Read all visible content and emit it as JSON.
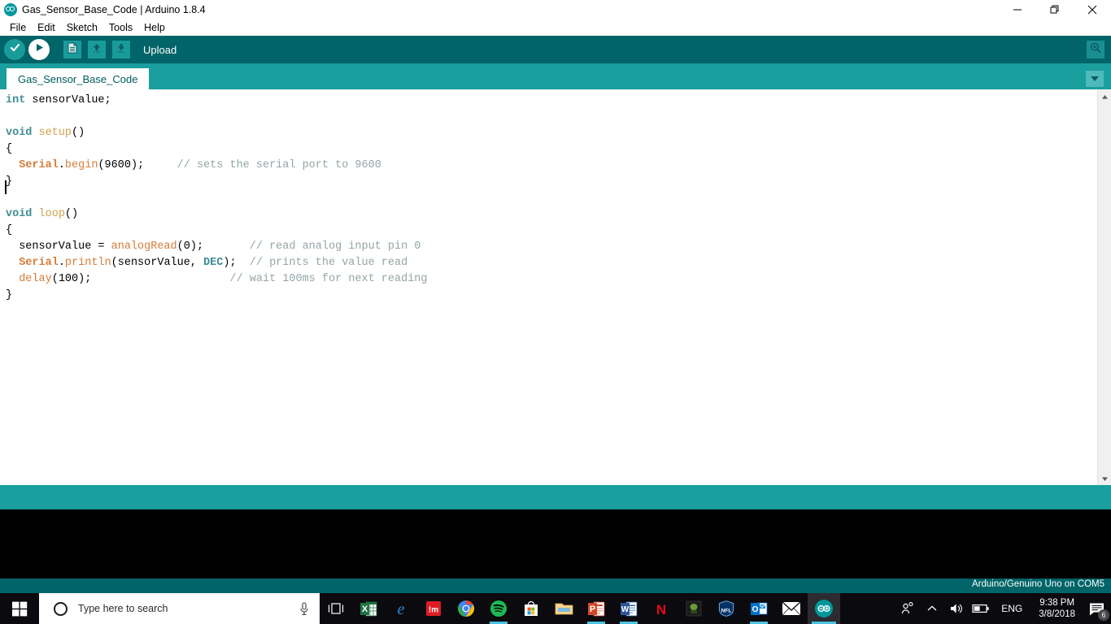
{
  "window": {
    "title": "Gas_Sensor_Base_Code | Arduino 1.8.4",
    "logo_icon": "arduino-infinity-icon",
    "controls": {
      "minimize": "minimize-icon",
      "restore": "restore-icon",
      "close": "close-icon"
    }
  },
  "menubar": {
    "items": [
      {
        "label": "File"
      },
      {
        "label": "Edit"
      },
      {
        "label": "Sketch"
      },
      {
        "label": "Tools"
      },
      {
        "label": "Help"
      }
    ]
  },
  "toolbar": {
    "verify_icon": "check-icon",
    "upload_icon": "arrow-right-icon",
    "new_icon": "new-file-icon",
    "open_icon": "open-arrow-up-icon",
    "save_icon": "save-arrow-down-icon",
    "tooltip": "Upload",
    "serial_monitor_icon": "magnifier-serial-monitor-icon"
  },
  "tabs": {
    "items": [
      {
        "label": "Gas_Sensor_Base_Code",
        "active": true
      }
    ],
    "menu_icon": "chevron-down-icon"
  },
  "editor": {
    "lines": [
      [
        {
          "t": "int",
          "c": "kw"
        },
        {
          "t": " sensorValue;",
          "c": ""
        }
      ],
      [
        {
          "t": "",
          "c": ""
        }
      ],
      [
        {
          "t": "void",
          "c": "kw"
        },
        {
          "t": " ",
          "c": ""
        },
        {
          "t": "setup",
          "c": "fn"
        },
        {
          "t": "()",
          "c": ""
        }
      ],
      [
        {
          "t": "{",
          "c": ""
        }
      ],
      [
        {
          "t": "  ",
          "c": ""
        },
        {
          "t": "Serial",
          "c": "lib"
        },
        {
          "t": ".",
          "c": ""
        },
        {
          "t": "begin",
          "c": "mth"
        },
        {
          "t": "(9600);     ",
          "c": ""
        },
        {
          "t": "// sets the serial port to 9600",
          "c": "cmt"
        }
      ],
      [
        {
          "t": "}",
          "c": ""
        }
      ],
      [
        {
          "t": "",
          "c": ""
        }
      ],
      [
        {
          "t": "void",
          "c": "kw"
        },
        {
          "t": " ",
          "c": ""
        },
        {
          "t": "loop",
          "c": "fn"
        },
        {
          "t": "()",
          "c": ""
        }
      ],
      [
        {
          "t": "{",
          "c": ""
        }
      ],
      [
        {
          "t": "  sensorValue = ",
          "c": ""
        },
        {
          "t": "analogRead",
          "c": "mth"
        },
        {
          "t": "(0);       ",
          "c": ""
        },
        {
          "t": "// read analog input pin 0",
          "c": "cmt"
        }
      ],
      [
        {
          "t": "  ",
          "c": ""
        },
        {
          "t": "Serial",
          "c": "lib"
        },
        {
          "t": ".",
          "c": ""
        },
        {
          "t": "println",
          "c": "mth"
        },
        {
          "t": "(sensorValue, ",
          "c": ""
        },
        {
          "t": "DEC",
          "c": "kw"
        },
        {
          "t": ");  ",
          "c": ""
        },
        {
          "t": "// prints the value read",
          "c": "cmt"
        }
      ],
      [
        {
          "t": "  ",
          "c": ""
        },
        {
          "t": "delay",
          "c": "mth"
        },
        {
          "t": "(100);                     ",
          "c": ""
        },
        {
          "t": "// wait 100ms for next reading",
          "c": "cmt"
        }
      ],
      [
        {
          "t": "}",
          "c": ""
        }
      ]
    ],
    "scroll_up_icon": "chevron-up-icon",
    "scroll_down_icon": "chevron-down-icon"
  },
  "status": {
    "board_text": "Arduino/Genuino Uno on COM5",
    "console_text": ""
  },
  "taskbar": {
    "start_icon": "windows-start-icon",
    "search": {
      "placeholder": "Type here to search",
      "circle_icon": "cortana-circle-icon",
      "mic_icon": "microphone-icon"
    },
    "taskview_icon": "task-view-icon",
    "apps": [
      {
        "name": "excel-icon",
        "label": "X"
      },
      {
        "name": "edge-icon",
        "label": "e"
      },
      {
        "name": "groove-music-icon",
        "label": "!m"
      },
      {
        "name": "chrome-icon",
        "label": ""
      },
      {
        "name": "spotify-icon",
        "label": ""
      },
      {
        "name": "microsoft-store-icon",
        "label": ""
      },
      {
        "name": "file-explorer-icon",
        "label": ""
      },
      {
        "name": "powerpoint-icon",
        "label": "P"
      },
      {
        "name": "word-icon",
        "label": "W"
      },
      {
        "name": "netflix-icon",
        "label": "N"
      },
      {
        "name": "game-app-icon",
        "label": ""
      },
      {
        "name": "nfl-icon",
        "label": "NFL"
      },
      {
        "name": "outlook-icon",
        "label": "O"
      },
      {
        "name": "mail-icon",
        "label": ""
      },
      {
        "name": "arduino-icon",
        "label": ""
      }
    ],
    "tray": {
      "people_icon": "people-icon",
      "show_hidden_icon": "chevron-up-icon",
      "volume_icon": "speaker-icon",
      "battery_icon": "battery-icon",
      "language": "ENG",
      "time": "9:38 PM",
      "date": "3/8/2018",
      "action_center_icon": "action-center-icon",
      "notification_count": "6"
    }
  },
  "colors": {
    "toolbar_dark_teal": "#006468",
    "tab_teal": "#1a9e9e",
    "accent_teal": "#00979c",
    "console_black": "#000000",
    "editor_white": "#ffffff"
  }
}
